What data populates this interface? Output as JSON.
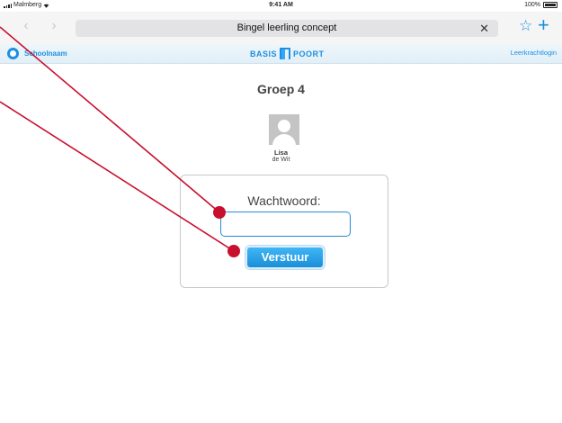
{
  "status_bar": {
    "carrier": "Malmberg",
    "time": "9:41 AM",
    "battery": "100%"
  },
  "browser": {
    "page_title": "Bingel leerling concept",
    "back_icon": "chevron-left-icon",
    "forward_icon": "chevron-right-icon",
    "close_icon": "close-icon",
    "bookmark_icon": "star-icon",
    "new_tab_icon": "plus-icon"
  },
  "header": {
    "school_name": "Schoolnaam",
    "logo_left": "BASIS",
    "logo_right": "POORT",
    "teacher_login": "Leerkrachtlogin"
  },
  "main": {
    "group_title": "Groep 4",
    "student_first_name": "Lisa",
    "student_last_name": "de Wit",
    "password_label": "Wachtwoord:",
    "password_value": "",
    "submit_label": "Verstuur"
  },
  "colors": {
    "accent": "#1d8fe0",
    "annotation_line": "#c8102e"
  }
}
